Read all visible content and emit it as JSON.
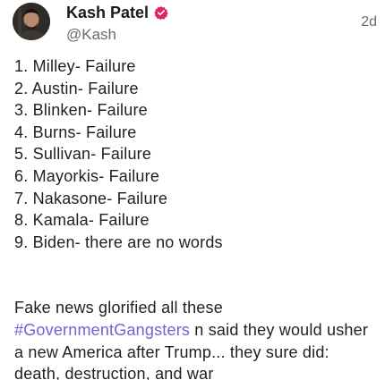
{
  "author": {
    "display_name": "Kash Patel",
    "handle": "@Kash",
    "verified_icon": "verified-badge-icon",
    "verified_color": "#e0245e"
  },
  "post": {
    "time": "2d",
    "list": [
      "1. Milley- Failure",
      "2. Austin- Failure",
      "3. Blinken- Failure",
      "4. Burns- Failure",
      "5. Sullivan- Failure",
      "6. Mayorkis- Failure",
      "7. Nakasone- Failure",
      "8. Kamala- Failure",
      "9. Biden- there are no words"
    ],
    "para_before": "Fake news glorified all these ",
    "hashtag": "#GovernmentGangsters",
    "para_after": " n said they would usher a new America after Trump... they sure did: death, destruction, and war"
  },
  "colors": {
    "hashtag": "#7a5cd6",
    "secondary_text": "#6b6b6b"
  }
}
